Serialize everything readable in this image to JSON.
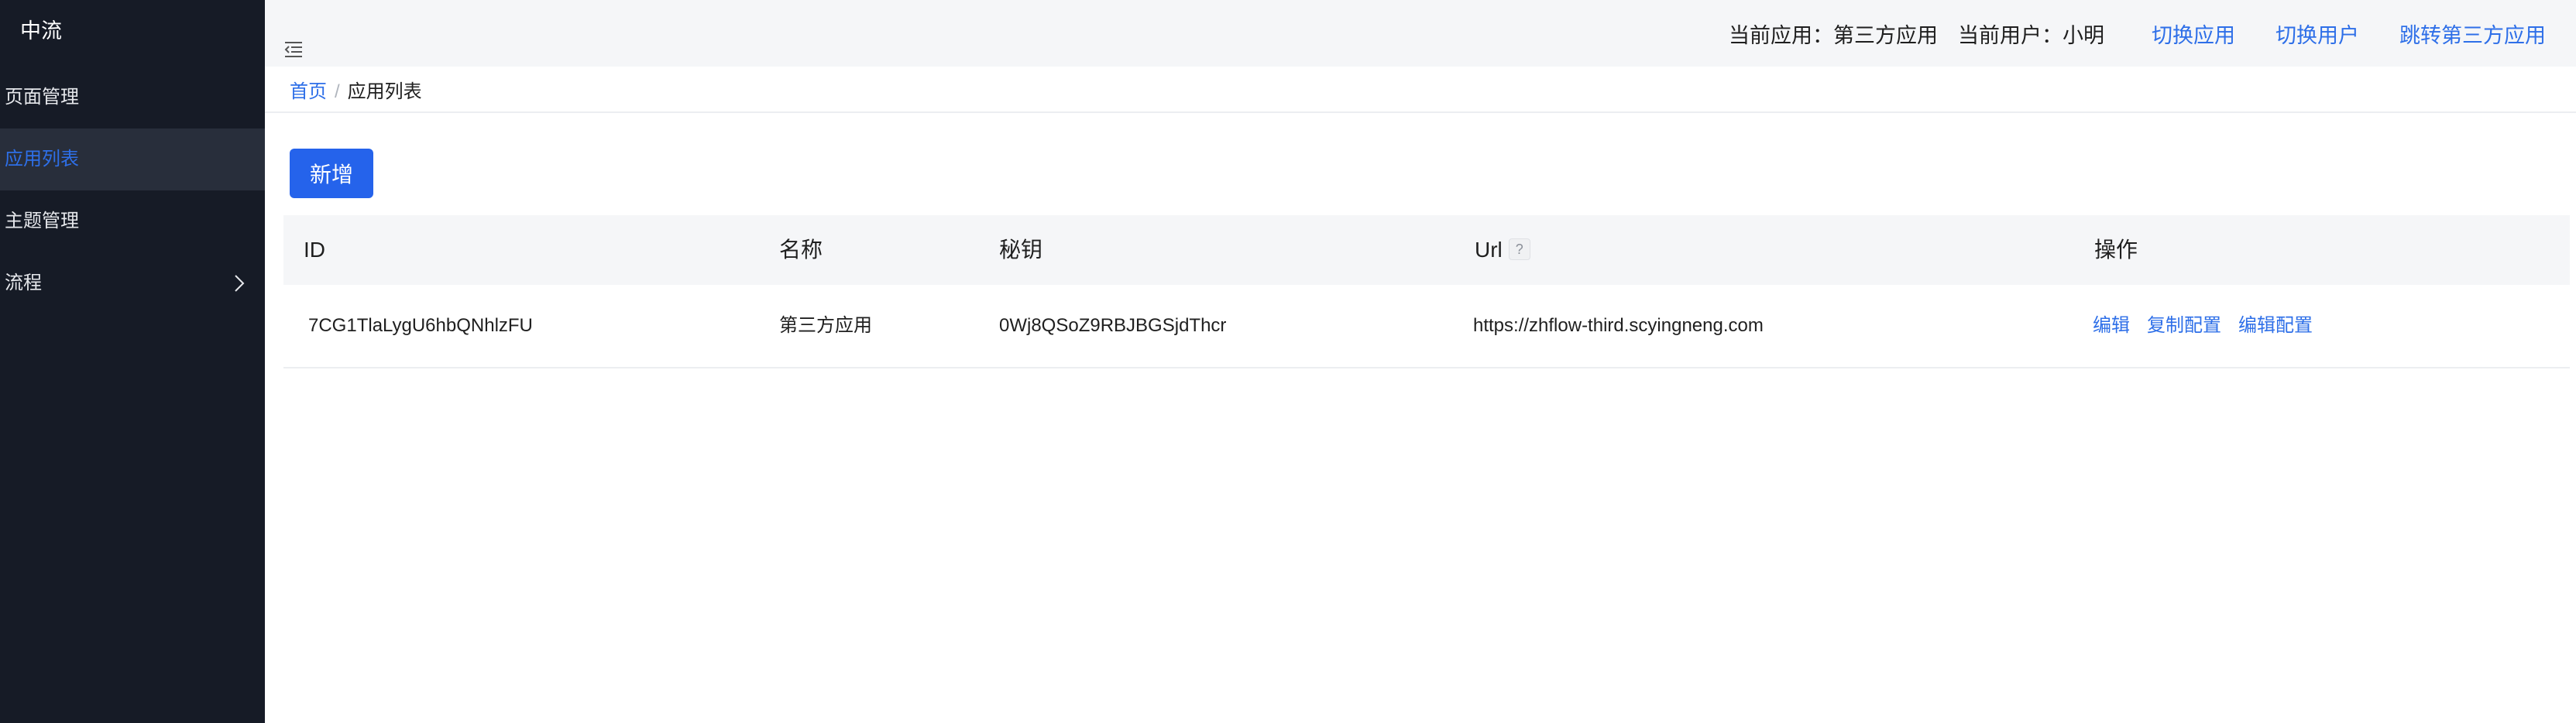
{
  "sidebar": {
    "logo": "中流",
    "items": [
      {
        "label": "页面管理"
      },
      {
        "label": "应用列表",
        "active": true
      },
      {
        "label": "主题管理"
      },
      {
        "label": "流程"
      }
    ]
  },
  "header": {
    "current_app_label": "当前应用：第三方应用",
    "current_user_label": "当前用户：小明",
    "switch_app": "切换应用",
    "switch_user": "切换用户",
    "jump_third_party": "跳转第三方应用"
  },
  "breadcrumb": {
    "home": "首页",
    "separator": "/",
    "current": "应用列表"
  },
  "toolbar": {
    "add_label": "新增"
  },
  "table": {
    "columns": [
      "ID",
      "名称",
      "秘钥",
      "Url",
      "操作"
    ],
    "url_help_icon": "?",
    "rows": [
      {
        "id": "7CG1TlaLygU6hbQNhlzFU",
        "name": "第三方应用",
        "secret": "0Wj8QSoZ9RBJBGSjdThcr",
        "url": "https://zhflow-third.scyingneng.com",
        "actions": [
          "编辑",
          "复制配置",
          "编辑配置"
        ]
      }
    ]
  },
  "colors": {
    "sidebar_bg": "#161b26",
    "sidebar_active_bg": "#282e3b",
    "accent": "#2e6fe8",
    "primary_button": "#2563eb",
    "header_bg": "#f5f6f8"
  }
}
